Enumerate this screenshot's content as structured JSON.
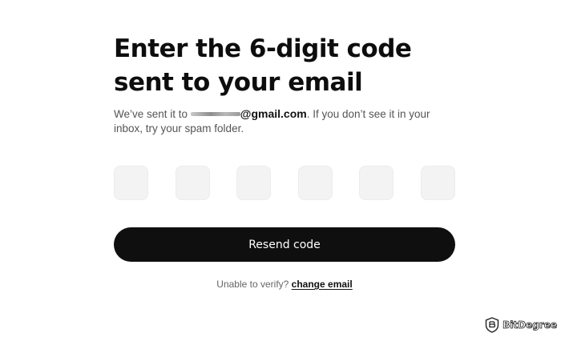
{
  "heading": {
    "line1": "Enter the 6-digit code",
    "line2": "sent to your email"
  },
  "description": {
    "prefix": "We’ve sent it to ",
    "email_suffix": "@gmail.com",
    "suffix": ". If you don’t see it in your inbox, try your spam folder."
  },
  "code_inputs": {
    "count": 6,
    "values": [
      "",
      "",
      "",
      "",
      "",
      ""
    ]
  },
  "resend_button": {
    "label": "Resend code"
  },
  "footer": {
    "prompt": "Unable to verify? ",
    "link_label": "change email"
  },
  "watermark": {
    "brand": "BitDegree"
  },
  "colors": {
    "background": "#ffffff",
    "primary": "#0f0f0f",
    "input_bg": "#f3f3f3",
    "muted_text": "#555555"
  }
}
